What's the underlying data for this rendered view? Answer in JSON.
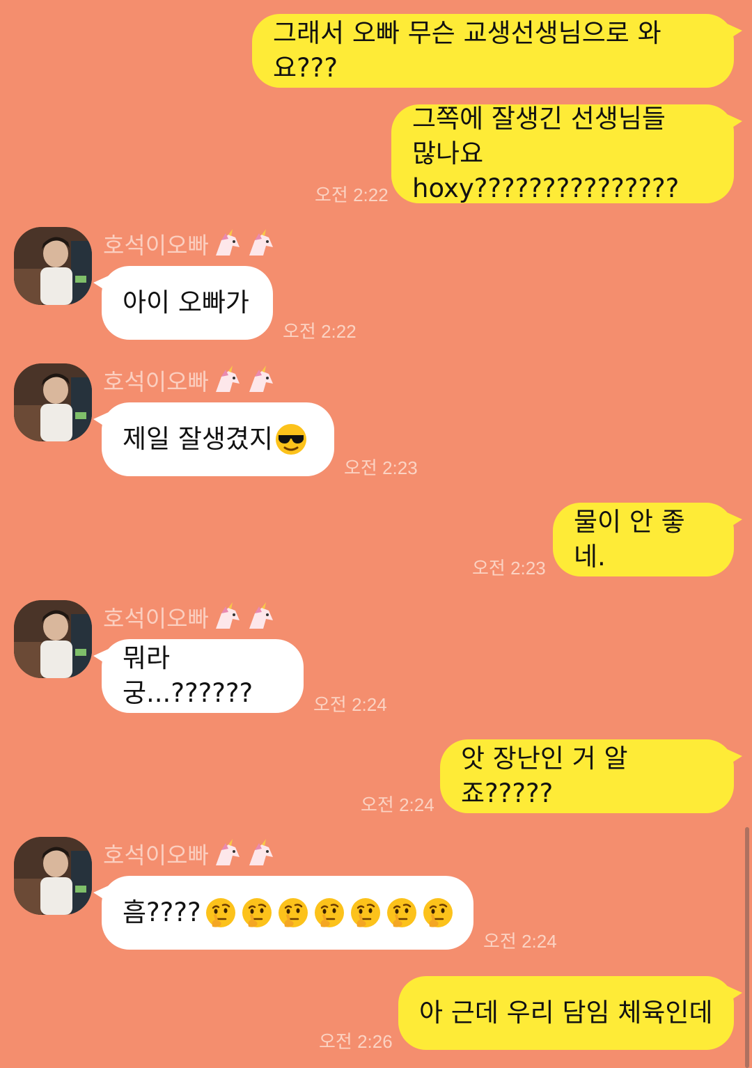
{
  "colors": {
    "background": "#F48E6E",
    "outgoing_bubble": "#FEEB37",
    "incoming_bubble": "#FFFFFF",
    "timestamp": "#FBD3C3",
    "sender_name": "#FBCFC0"
  },
  "messages": [
    {
      "direction": "out",
      "text": "그래서 오빠 무슨 교생선생님으로 와요???",
      "time": ""
    },
    {
      "direction": "out",
      "text": "그쪽에 잘생긴 선생님들\n많나요hoxy???????????????",
      "time": "오전 2:22"
    },
    {
      "direction": "in",
      "sender": "호석이오빠",
      "sender_emoji": "unicorn-icon",
      "text": "아이 오빠가",
      "time": "오전 2:22"
    },
    {
      "direction": "in",
      "sender": "호석이오빠",
      "sender_emoji": "unicorn-icon",
      "text": "제일 잘생겼지",
      "trailing_emoji": "sunglasses-emoji-icon",
      "time": "오전 2:23"
    },
    {
      "direction": "out",
      "text": "물이 안 좋네.",
      "time": "오전 2:23"
    },
    {
      "direction": "in",
      "sender": "호석이오빠",
      "sender_emoji": "unicorn-icon",
      "text": "뭐라궁...??????",
      "time": "오전 2:24"
    },
    {
      "direction": "out",
      "text": "앗 장난인 거 알죠?????",
      "time": "오전 2:24"
    },
    {
      "direction": "in",
      "sender": "호석이오빠",
      "sender_emoji": "unicorn-icon",
      "text": "흠????",
      "trailing_emoji": "thinking-face-emoji-icon",
      "trailing_emoji_count": 7,
      "time": "오전 2:24"
    },
    {
      "direction": "out",
      "text": "아 근데 우리 담임 체육인데",
      "time": "오전 2:26"
    }
  ]
}
